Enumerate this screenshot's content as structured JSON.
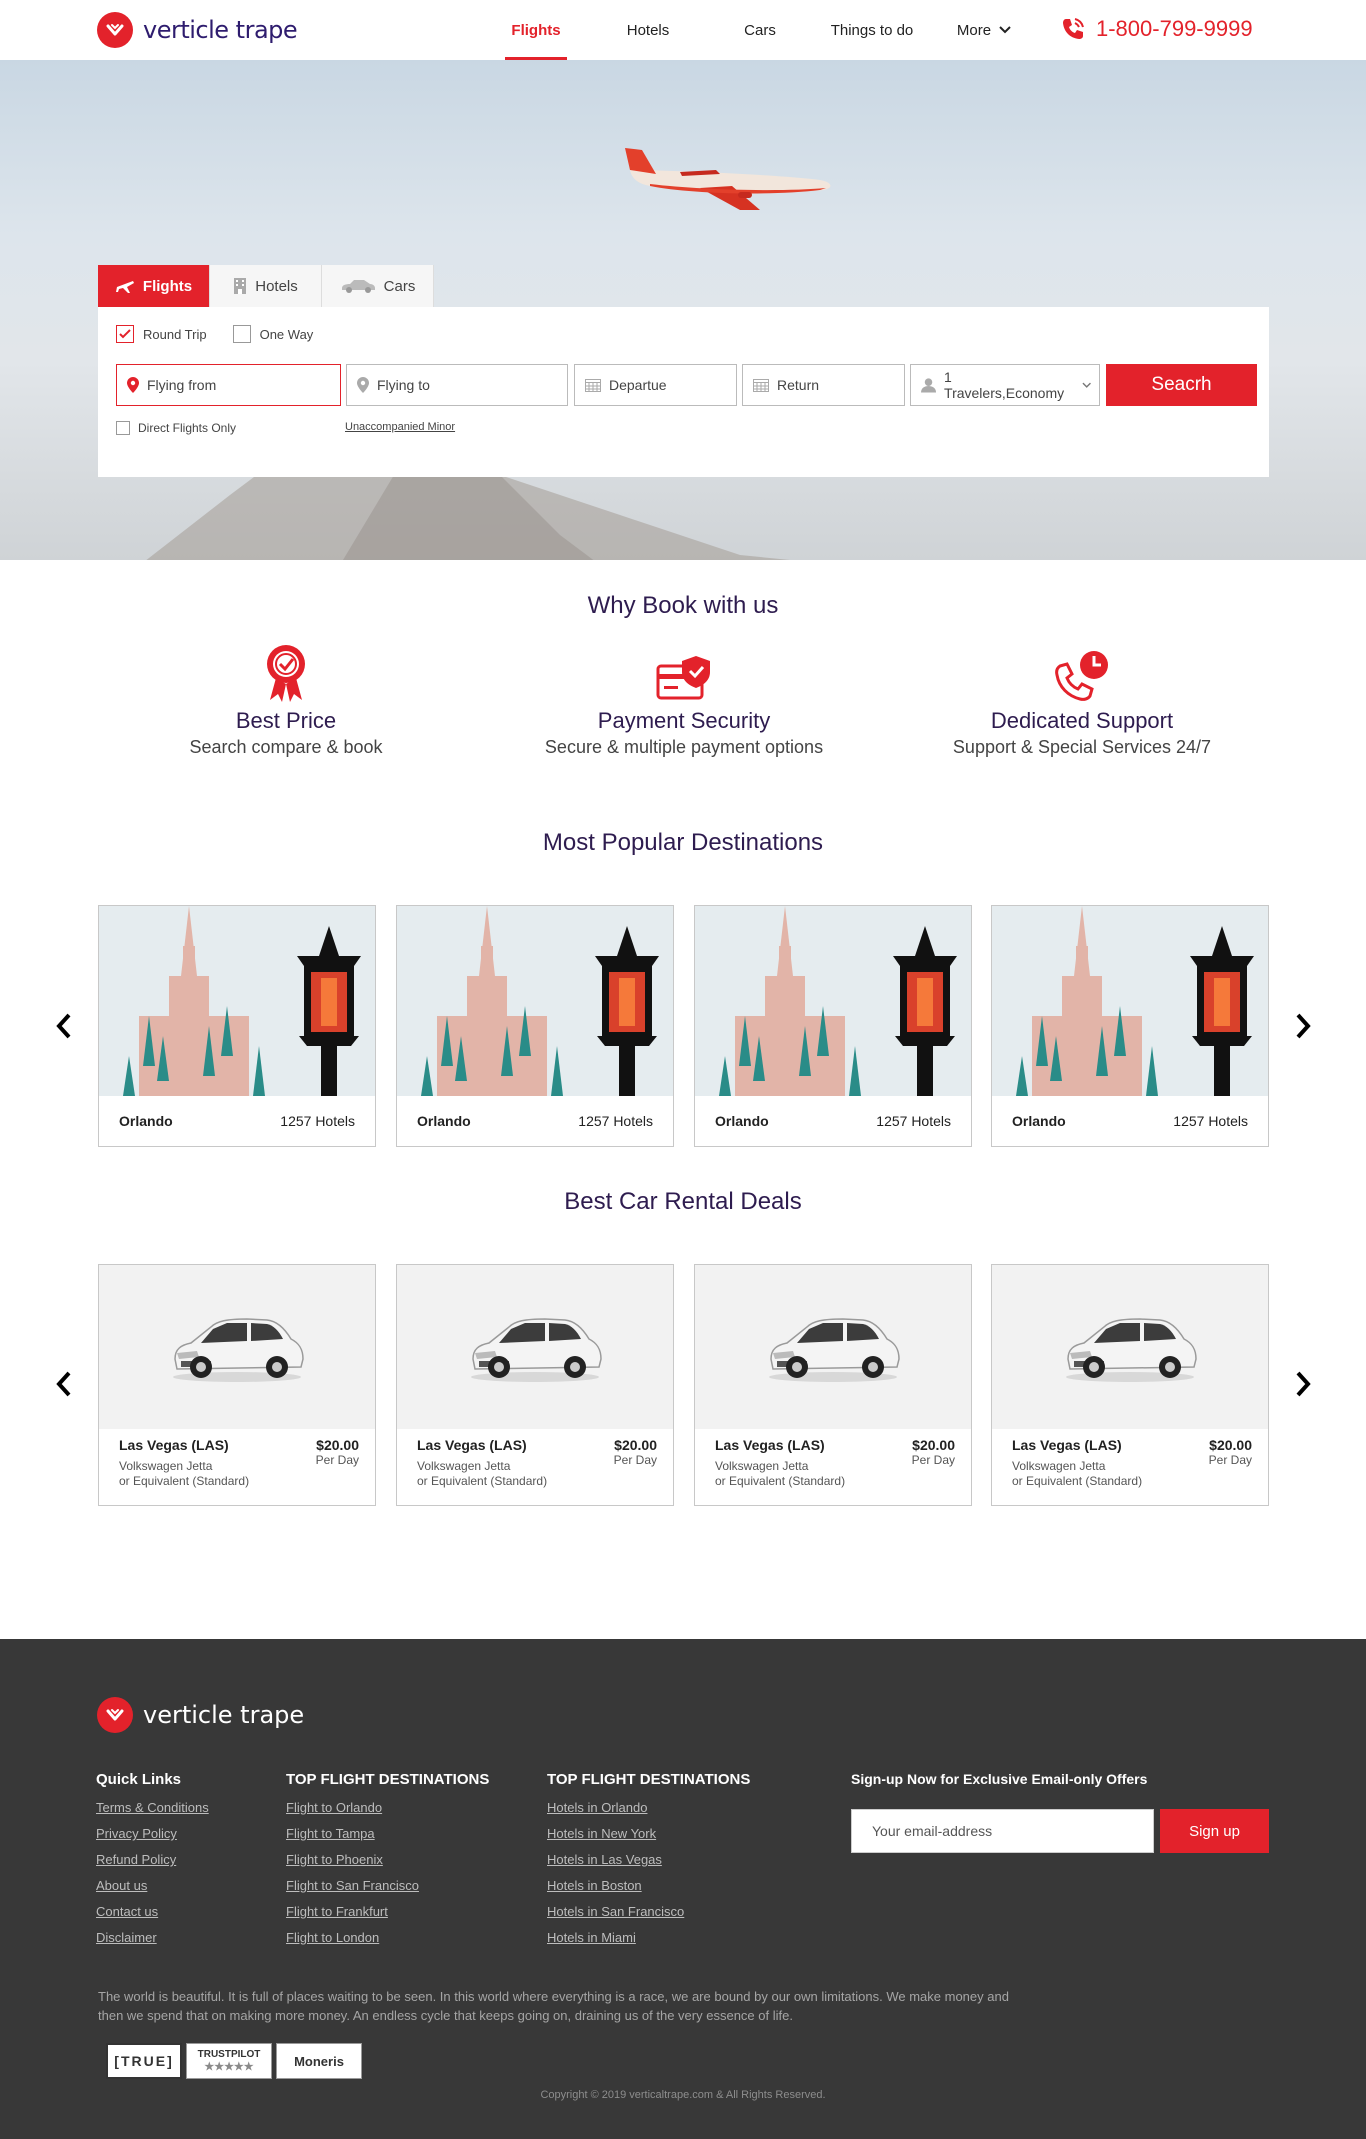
{
  "brand": {
    "name": "verticle trape",
    "accent": "#e3222b",
    "primary_text": "#2e1c4f"
  },
  "nav": {
    "items": [
      {
        "label": "Flights",
        "active": true
      },
      {
        "label": "Hotels"
      },
      {
        "label": "Cars"
      },
      {
        "label": "Things to do"
      },
      {
        "label": "More"
      }
    ],
    "phone": "1-800-799-9999"
  },
  "search": {
    "tabs": [
      {
        "label": "Flights",
        "icon": "plane-icon",
        "active": true
      },
      {
        "label": "Hotels",
        "icon": "building-icon"
      },
      {
        "label": "Cars",
        "icon": "car-icon"
      }
    ],
    "trip_types": [
      {
        "label": "Round Trip",
        "checked": true
      },
      {
        "label": "One Way",
        "checked": false
      }
    ],
    "flying_from": "Flying from",
    "flying_to": "Flying to",
    "departure": "Departue",
    "return": "Return",
    "travelers": "1 Travelers,Economy",
    "button": "Seacrh",
    "direct_flights": "Direct Flights Only",
    "unaccompanied": "Unaccompanied Minor"
  },
  "why": {
    "title": "Why Book with us",
    "features": [
      {
        "title": "Best Price",
        "subtitle": "Search compare & book",
        "icon": "award-ribbon-icon"
      },
      {
        "title": "Payment Security",
        "subtitle": "Secure & multiple payment options",
        "icon": "secure-card-icon"
      },
      {
        "title": "Dedicated Support",
        "subtitle": "Support & Special Services 24/7",
        "icon": "phone-clock-icon"
      }
    ]
  },
  "destinations": {
    "title": "Most Popular Destinations",
    "items": [
      {
        "city": "Orlando",
        "hotels": "1257 Hotels"
      },
      {
        "city": "Orlando",
        "hotels": "1257 Hotels"
      },
      {
        "city": "Orlando",
        "hotels": "1257 Hotels"
      },
      {
        "city": "Orlando",
        "hotels": "1257 Hotels"
      }
    ]
  },
  "cars": {
    "title": "Best Car Rental Deals",
    "items": [
      {
        "city": "Las Vegas (LAS)",
        "price": "$20.00",
        "per": "Per Day",
        "model_1": "Volkswagen Jetta",
        "model_2": "or Equivalent (Standard)"
      },
      {
        "city": "Las Vegas (LAS)",
        "price": "$20.00",
        "per": "Per Day",
        "model_1": "Volkswagen Jetta",
        "model_2": "or Equivalent (Standard)"
      },
      {
        "city": "Las Vegas (LAS)",
        "price": "$20.00",
        "per": "Per Day",
        "model_1": "Volkswagen Jetta",
        "model_2": "or Equivalent (Standard)"
      },
      {
        "city": "Las Vegas (LAS)",
        "price": "$20.00",
        "per": "Per Day",
        "model_1": "Volkswagen Jetta",
        "model_2": "or Equivalent (Standard)"
      }
    ]
  },
  "footer": {
    "quick_links_title": "Quick Links",
    "quick_links": [
      "Terms & Conditions",
      "Privacy Policy",
      "Refund Policy",
      "About us",
      "Contact us",
      "Disclaimer"
    ],
    "flights_title": "TOP FLIGHT DESTINATIONS",
    "flights": [
      "Flight to Orlando",
      "Flight to Tampa",
      "Flight to Phoenix",
      "Flight to San Francisco",
      "Flight to Frankfurt",
      "Flight to London"
    ],
    "hotels_title": "TOP FLIGHT DESTINATIONS",
    "hotels": [
      "Hotels in Orlando",
      "Hotels in New York",
      "Hotels in Las Vegas",
      "Hotels in Boston",
      "Hotels in San Francisco",
      "Hotels in Miami"
    ],
    "signup_title": "Sign-up Now for Exclusive Email-only Offers",
    "email_placeholder": "Your email-address",
    "signup_button": "Sign up",
    "blurb": "The world is beautiful. It is full of places waiting to be seen. In this world where everything is a race, we are bound by our own limitations. We make money and then we spend that on making more money. An endless cycle that keeps going on, draining us of the very essence of life.",
    "badges": [
      "TRUE",
      "TRUSTPILOT",
      "Moneris"
    ],
    "copyright": "Copyright © 2019 verticaltrape.com & All Rights Reserved."
  }
}
